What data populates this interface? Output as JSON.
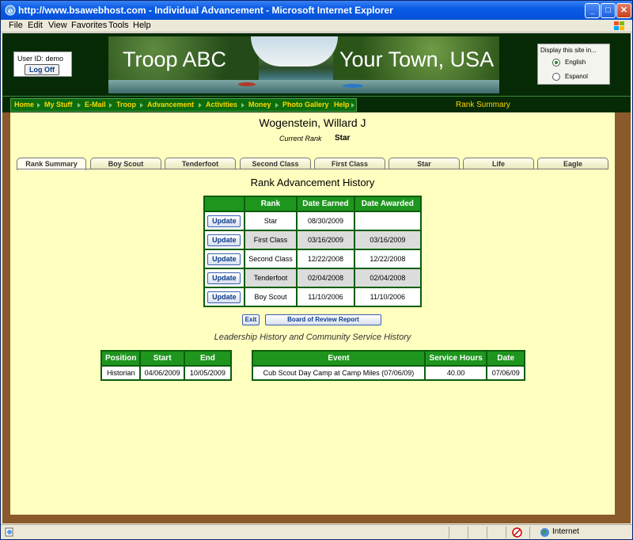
{
  "window": {
    "title": "http://www.bsawebhost.com - Individual Advancement - Microsoft Internet Explorer",
    "menu": [
      "File",
      "Edit",
      "View",
      "Favorites",
      "Tools",
      "Help"
    ]
  },
  "header": {
    "user_id": "User ID: demo",
    "logoff": "Log Off",
    "banner_left": "Troop ABC",
    "banner_right": "Your Town, USA",
    "language_label": "Display this site in...",
    "lang_options": [
      "English",
      "Espanol"
    ],
    "lang_selected": "English"
  },
  "nav": {
    "items": [
      "Home",
      "My Stuff",
      "E-Mail",
      "Troop",
      "Advancement",
      "Activities",
      "Money",
      "Photo Gallery",
      "Help"
    ],
    "page_title": "Rank Summary"
  },
  "scout": {
    "name": "Wogenstein, Willard J",
    "current_rank_label": "Current Rank",
    "current_rank": "Star"
  },
  "tabs": [
    "Rank Summary",
    "Boy Scout",
    "Tenderfoot",
    "Second Class",
    "First Class",
    "Star",
    "Life",
    "Eagle"
  ],
  "rank_history": {
    "title": "Rank Advancement History",
    "columns": [
      "",
      "Rank",
      "Date Earned",
      "Date Awarded"
    ],
    "update_label": "Update",
    "rows": [
      {
        "rank": "Star",
        "earned": "08/30/2009",
        "awarded": ""
      },
      {
        "rank": "First Class",
        "earned": "03/16/2009",
        "awarded": "03/16/2009"
      },
      {
        "rank": "Second Class",
        "earned": "12/22/2008",
        "awarded": "12/22/2008"
      },
      {
        "rank": "Tenderfoot",
        "earned": "02/04/2008",
        "awarded": "02/04/2008"
      },
      {
        "rank": "Boy Scout",
        "earned": "11/10/2006",
        "awarded": "11/10/2006"
      }
    ]
  },
  "buttons": {
    "exit": "Exit",
    "board_report": "Board of Review Report"
  },
  "leadership": {
    "title": "Leadership History and Community Service History",
    "columns": [
      "Position",
      "Start",
      "End"
    ],
    "rows": [
      {
        "position": "Historian",
        "start": "04/06/2009",
        "end": "10/05/2009"
      }
    ]
  },
  "service": {
    "columns": [
      "Event",
      "Service Hours",
      "Date"
    ],
    "rows": [
      {
        "event": "Cub Scout Day Camp at Camp Miles (07/06/09)",
        "hours": "40.00",
        "date": "07/06/09"
      }
    ]
  },
  "status": {
    "zone": "Internet"
  },
  "colors": {
    "header_bg": "#052a05",
    "table_header": "#1e961e",
    "page_bg": "#ffffc0",
    "nav_text": "#ffd700"
  }
}
